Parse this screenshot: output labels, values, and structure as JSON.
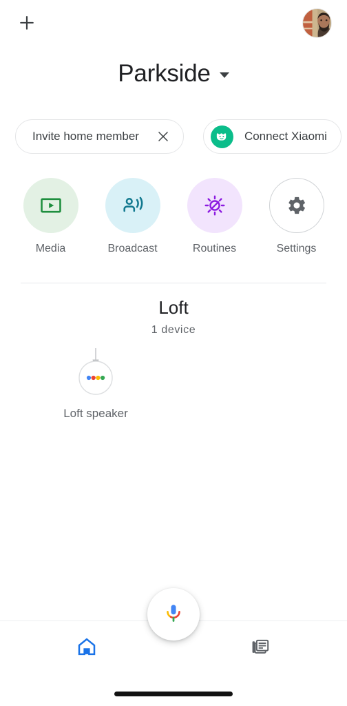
{
  "topbar": {
    "add_icon": "plus-icon",
    "avatar_alt": "account-avatar"
  },
  "home": {
    "title": "Parkside",
    "dropdown_icon": "chevron-down-icon"
  },
  "chips": [
    {
      "id": "invite-home-member",
      "label": "Invite home member",
      "close_icon": "close-icon"
    },
    {
      "id": "connect-xiaomi",
      "label": "Connect Xiaomi",
      "logo_icon": "mi-home-logo-icon",
      "logo_color": "#0bbd8a"
    }
  ],
  "quick_actions": [
    {
      "id": "media",
      "label": "Media",
      "icon": "media-play-icon",
      "bg": "#e3f1e4",
      "fg": "#1e8e3e"
    },
    {
      "id": "broadcast",
      "label": "Broadcast",
      "icon": "broadcast-icon",
      "bg": "#d9f1f7",
      "fg": "#12798f"
    },
    {
      "id": "routines",
      "label": "Routines",
      "icon": "routines-sun-icon",
      "bg": "#f2e4fd",
      "fg": "#8c1ae0"
    },
    {
      "id": "settings",
      "label": "Settings",
      "icon": "gear-icon",
      "bg": "#ffffff",
      "fg": "#5f6368"
    }
  ],
  "room": {
    "name": "Loft",
    "device_count": "1 device",
    "devices": [
      {
        "id": "loft-speaker",
        "label": "Loft  speaker",
        "icon": "google-speaker-icon",
        "dot_colors": [
          "#4285f4",
          "#ea4335",
          "#fbbc04",
          "#34a853"
        ]
      }
    ]
  },
  "assistant": {
    "fab_icon": "google-assistant-mic-icon"
  },
  "bottom_nav": [
    {
      "id": "home",
      "icon": "home-icon",
      "active": true,
      "color": "#1a73e8"
    },
    {
      "id": "feed",
      "icon": "feed-icon",
      "active": false,
      "color": "#5f6368"
    }
  ],
  "system": {
    "home_indicator": "home-indicator-bar"
  }
}
